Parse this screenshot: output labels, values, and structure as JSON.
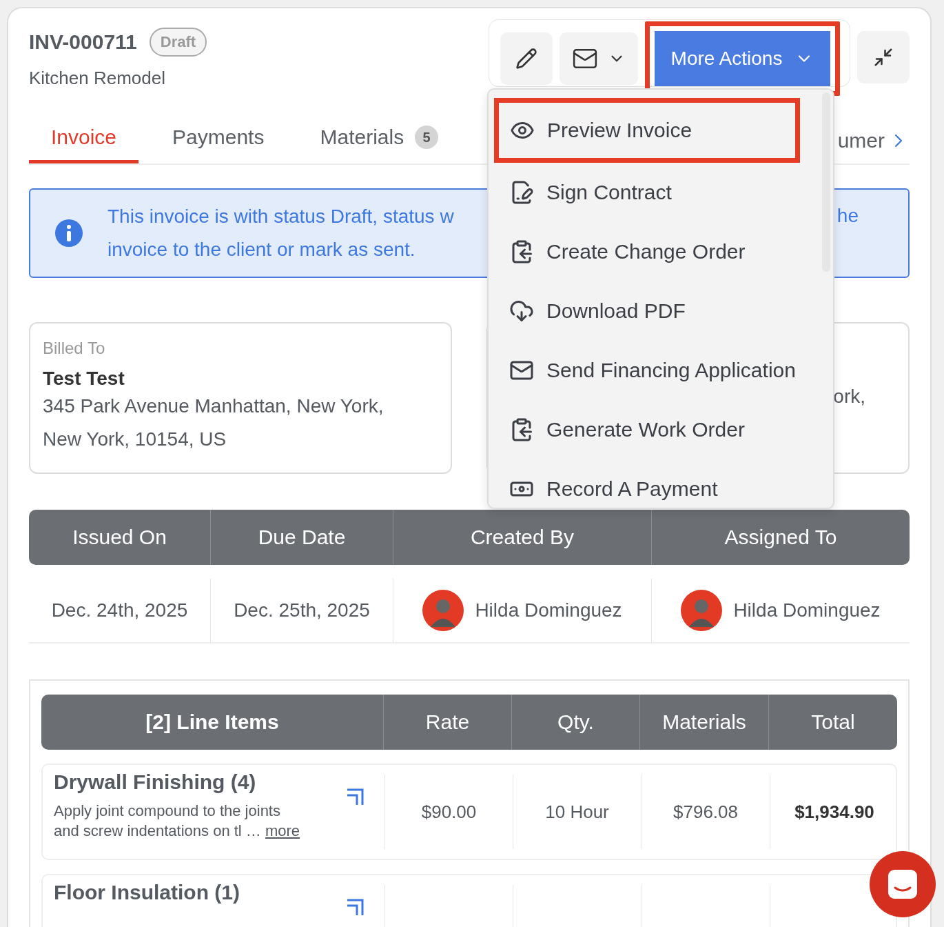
{
  "header": {
    "title": "INV-000711",
    "status": "Draft",
    "subtitle": "Kitchen Remodel"
  },
  "toolbar": {
    "more_actions": {
      "label": "More Actions",
      "highlighted": true
    }
  },
  "tabs": [
    {
      "label": "Invoice",
      "selected": true
    },
    {
      "label": "Payments",
      "selected": false
    },
    {
      "label": "Materials",
      "badge": "5",
      "selected": false
    },
    {
      "label": "umer",
      "selected": false
    }
  ],
  "banner": {
    "lines": [
      "This invoice is with status Draft, status w",
      "invoice to the client or mark as sent."
    ],
    "fragment": "he"
  },
  "billed_to": {
    "heading": "Billed To",
    "name": "Test Test",
    "address": [
      "345 Park Avenue Manhattan, New York,",
      "New York, 10154, US"
    ]
  },
  "second_card": {
    "fragment": "ork,"
  },
  "details": {
    "columns": [
      "Issued On",
      "Due Date",
      "Created By",
      "Assigned To"
    ],
    "values": [
      {
        "kind": "text",
        "text": "Dec. 24th, 2025"
      },
      {
        "kind": "text",
        "text": "Dec. 25th, 2025"
      },
      {
        "kind": "person",
        "text": "Hilda Dominguez"
      },
      {
        "kind": "person",
        "text": "Hilda Dominguez"
      }
    ]
  },
  "line_items": {
    "columns": [
      "[2] Line Items",
      "Rate",
      "Qty.",
      "Materials",
      "Total"
    ],
    "rows": [
      {
        "name": "Drywall Finishing (4)",
        "description": [
          "Apply joint compound to the joints",
          "and screw indentations on tl …"
        ],
        "more": "more",
        "rate": "$90.00",
        "qty": "10 Hour",
        "materials": "$796.08",
        "total": "$1,934.90"
      },
      {
        "name": "Floor Insulation (1)"
      }
    ]
  },
  "menu": {
    "items": [
      {
        "kind": "eye",
        "label": "Preview Invoice",
        "highlighted": true
      },
      {
        "kind": "sign",
        "label": "Sign Contract",
        "highlighted": false
      },
      {
        "kind": "clipboard",
        "label": "Create Change Order",
        "highlighted": false
      },
      {
        "kind": "download",
        "label": "Download PDF",
        "highlighted": false
      },
      {
        "kind": "mail",
        "label": "Send Financing Application",
        "highlighted": false
      },
      {
        "kind": "clipboard",
        "label": "Generate Work Order",
        "highlighted": false
      },
      {
        "kind": "money",
        "label": "Record A Payment",
        "highlighted": false
      }
    ]
  }
}
